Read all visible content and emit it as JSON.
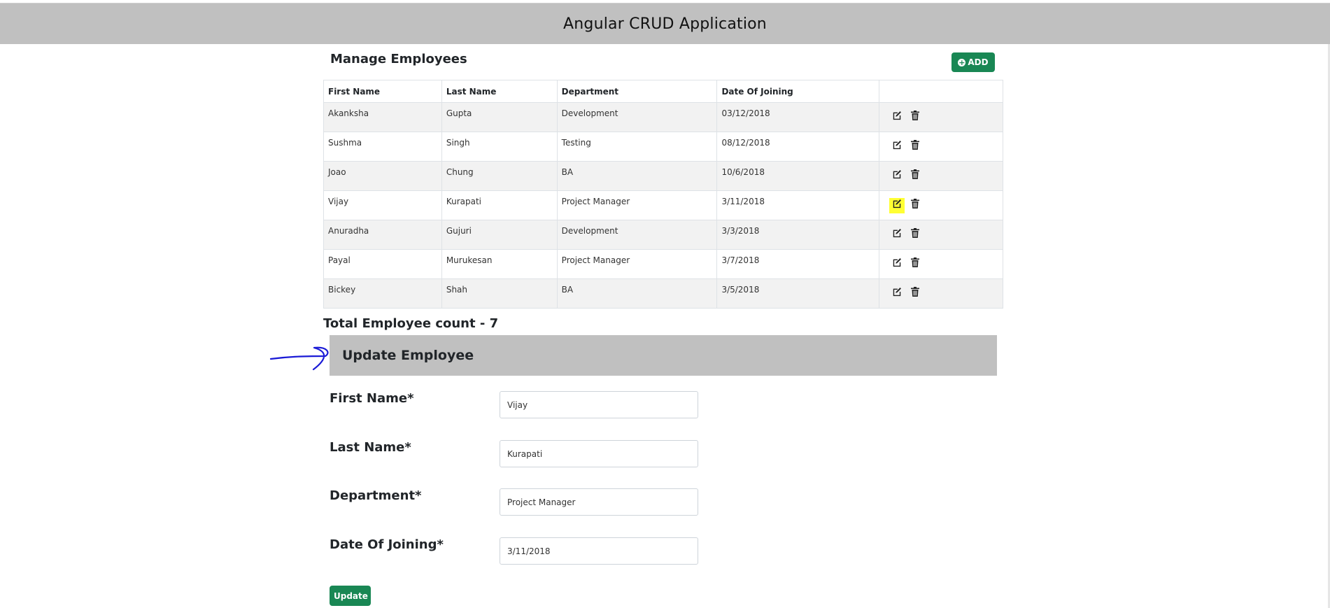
{
  "app": {
    "title": "Angular CRUD Application"
  },
  "manage": {
    "title": "Manage Employees",
    "add_label": "ADD"
  },
  "table": {
    "columns": [
      "First Name",
      "Last Name",
      "Department",
      "Date Of Joining"
    ],
    "rows": [
      {
        "first": "Akanksha",
        "last": "Gupta",
        "dept": "Development",
        "doj": "03/12/2018"
      },
      {
        "first": "Sushma",
        "last": "Singh",
        "dept": "Testing",
        "doj": "08/12/2018"
      },
      {
        "first": "Joao",
        "last": "Chung",
        "dept": "BA",
        "doj": "10/6/2018"
      },
      {
        "first": "Vijay",
        "last": "Kurapati",
        "dept": "Project Manager",
        "doj": "3/11/2018"
      },
      {
        "first": "Anuradha",
        "last": "Gujuri",
        "dept": "Development",
        "doj": "3/3/2018"
      },
      {
        "first": "Payal",
        "last": "Murukesan",
        "dept": "Project Manager",
        "doj": "3/7/2018"
      },
      {
        "first": "Bickey",
        "last": "Shah",
        "dept": "BA",
        "doj": "3/5/2018"
      }
    ],
    "icons": {
      "edit": "edit-icon",
      "delete": "trash-icon"
    }
  },
  "total_text": "Total Employee count - 7",
  "update": {
    "title": "Update Employee",
    "first_label": "First Name*",
    "last_label": "Last Name*",
    "dept_label": "Department*",
    "doj_label": "Date Of Joining*",
    "first_value": "Vijay",
    "last_value": "Kurapati",
    "dept_value": "Project Manager",
    "doj_value": "3/11/2018",
    "button_label": "Update"
  },
  "colors": {
    "header_bg": "#c0c0c0",
    "button_green": "#198754",
    "highlight": "#ffff33",
    "annotation": "#1a1ad6"
  }
}
